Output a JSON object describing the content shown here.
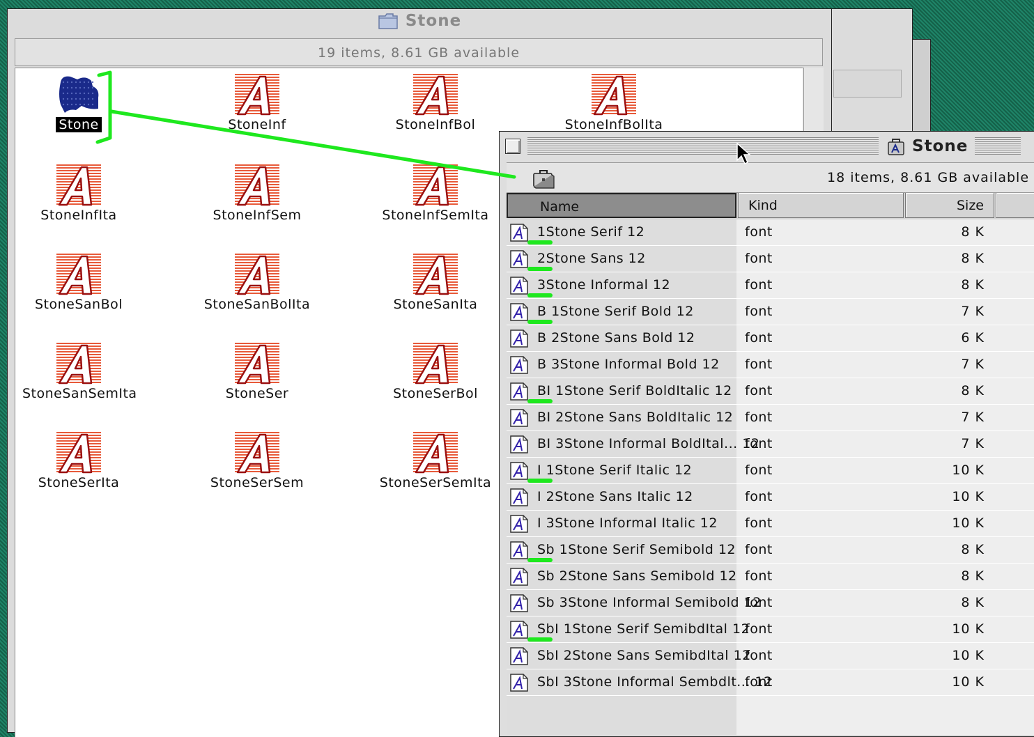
{
  "back_window": {
    "title": "Stone",
    "status": "19 items, 8.61 GB available",
    "files": [
      {
        "name": "Stone",
        "type": "suitcase",
        "selected": true
      },
      {
        "name": "StoneInf",
        "type": "font"
      },
      {
        "name": "StoneInfBol",
        "type": "font"
      },
      {
        "name": "StoneInfBolIta",
        "type": "font"
      },
      {
        "name": "StoneInfIta",
        "type": "font"
      },
      {
        "name": "StoneInfSem",
        "type": "font"
      },
      {
        "name": "StoneInfSemIta",
        "type": "font"
      },
      {
        "name": "StoneSanBol",
        "type": "font"
      },
      {
        "name": "StoneSanBolIta",
        "type": "font"
      },
      {
        "name": "StoneSanIta",
        "type": "font"
      },
      {
        "name": "StoneSanSemIta",
        "type": "font"
      },
      {
        "name": "StoneSer",
        "type": "font"
      },
      {
        "name": "StoneSerBol",
        "type": "font"
      },
      {
        "name": "StoneSerIta",
        "type": "font"
      },
      {
        "name": "StoneSerSem",
        "type": "font"
      },
      {
        "name": "StoneSerSemIta",
        "type": "font"
      }
    ]
  },
  "front_window": {
    "title": "Stone",
    "status": "18 items, 8.61 GB available",
    "columns": {
      "name": "Name",
      "kind": "Kind",
      "size": "Size"
    },
    "rows": [
      {
        "name": "1Stone Serif 12",
        "kind": "font",
        "size": "8 K",
        "mark": 1
      },
      {
        "name": "2Stone Sans 12",
        "kind": "font",
        "size": "8 K",
        "mark": 1
      },
      {
        "name": "3Stone Informal 12",
        "kind": "font",
        "size": "8 K",
        "mark": 1
      },
      {
        "name": "B 1Stone Serif Bold 12",
        "kind": "font",
        "size": "7 K",
        "mark": 1
      },
      {
        "name": "B 2Stone Sans Bold 12",
        "kind": "font",
        "size": "6 K",
        "mark": 0
      },
      {
        "name": "B 3Stone Informal Bold 12",
        "kind": "font",
        "size": "7 K",
        "mark": 0
      },
      {
        "name": "BI 1Stone Serif BoldItalic 12",
        "kind": "font",
        "size": "8 K",
        "mark": 1
      },
      {
        "name": "BI 2Stone Sans BoldItalic 12",
        "kind": "font",
        "size": "7 K",
        "mark": 0
      },
      {
        "name": "BI 3Stone Informal BoldItal... 12",
        "kind": "font",
        "size": "7 K",
        "mark": 0
      },
      {
        "name": "I 1Stone Serif Italic 12",
        "kind": "font",
        "size": "10 K",
        "mark": 1
      },
      {
        "name": "I 2Stone Sans Italic 12",
        "kind": "font",
        "size": "10 K",
        "mark": 0
      },
      {
        "name": "I 3Stone Informal Italic 12",
        "kind": "font",
        "size": "10 K",
        "mark": 0
      },
      {
        "name": "Sb 1Stone Serif Semibold 12",
        "kind": "font",
        "size": "8 K",
        "mark": 1
      },
      {
        "name": "Sb 2Stone Sans Semibold 12",
        "kind": "font",
        "size": "8 K",
        "mark": 0
      },
      {
        "name": "Sb 3Stone Informal Semibold 12",
        "kind": "font",
        "size": "8 K",
        "mark": 0
      },
      {
        "name": "SbI 1Stone Serif SemibdItal 12",
        "kind": "font",
        "size": "10 K",
        "mark": 1
      },
      {
        "name": "SbI 2Stone Sans SemibdItal 12",
        "kind": "font",
        "size": "10 K",
        "mark": 0
      },
      {
        "name": "SbI 3Stone Informal Sembdlt... 12",
        "kind": "font",
        "size": "10 K",
        "mark": 0
      }
    ]
  },
  "colors": {
    "desktop": "#1c7a62",
    "annotation": "#1ee81e",
    "font_icon": "#e85a3a",
    "suitcase": "#1a2a8a"
  },
  "icons": {
    "folder": "folder-icon",
    "suitcase": "font-suitcase-icon",
    "font": "font-file-icon",
    "briefcase": "briefcase-icon",
    "cursor": "arrow-cursor-icon"
  }
}
